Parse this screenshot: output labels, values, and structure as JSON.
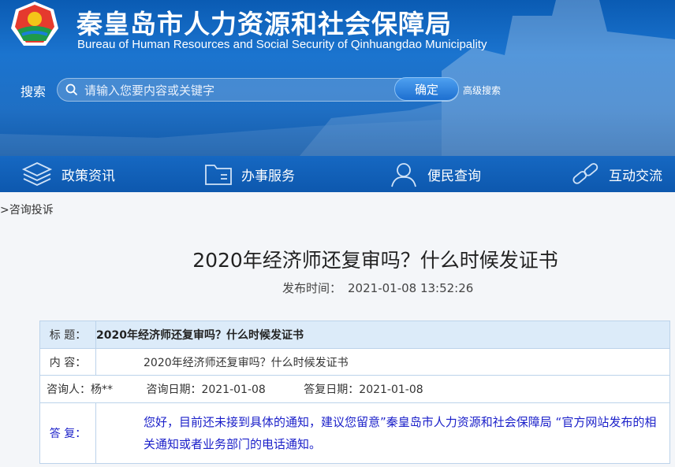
{
  "header": {
    "title": "秦皇岛市人力资源和社会保障局",
    "subtitle": "Bureau of Human Resources and Social Security of Qinhuangdao Municipality"
  },
  "search": {
    "label": "搜索",
    "placeholder": "请输入您要内容或关键字",
    "confirm_label": "确定",
    "advanced_label": "高级搜索"
  },
  "nav": {
    "items": [
      {
        "label": "政策资讯",
        "icon": "layers-icon"
      },
      {
        "label": "办事服务",
        "icon": "folder-icon"
      },
      {
        "label": "便民查询",
        "icon": "user-icon"
      },
      {
        "label": "互动交流",
        "icon": "link-icon"
      }
    ]
  },
  "breadcrumb": ">咨询投诉",
  "article": {
    "title": "2020年经济师还复审吗？什么时候发证书",
    "publish_label": "发布时间：",
    "publish_time": "2021-01-08 13:52:26"
  },
  "qa": {
    "title_label": "标  题：",
    "title_value": "2020年经济师还复审吗？什么时候发证书",
    "content_label": "内  容：",
    "content_value": "2020年经济师还复审吗？什么时候发证书",
    "asker_label": "咨询人：杨**",
    "ask_date_label": "咨询日期：",
    "ask_date": "2021-01-08",
    "reply_date_label": "答复日期：",
    "reply_date": "2021-01-08",
    "answer_label": "答  复：",
    "answer_value": "您好，目前还未接到具体的通知，建议您留意”秦皇岛市人力资源和社会保障局 “官方网站发布的相关通知或者业务部门的电话通知。"
  },
  "colors": {
    "header_blue": "#1b74cf",
    "nav_blue": "#1668c2",
    "title_row_bg": "#dcebf9",
    "answer_text": "#1a1fc9"
  }
}
